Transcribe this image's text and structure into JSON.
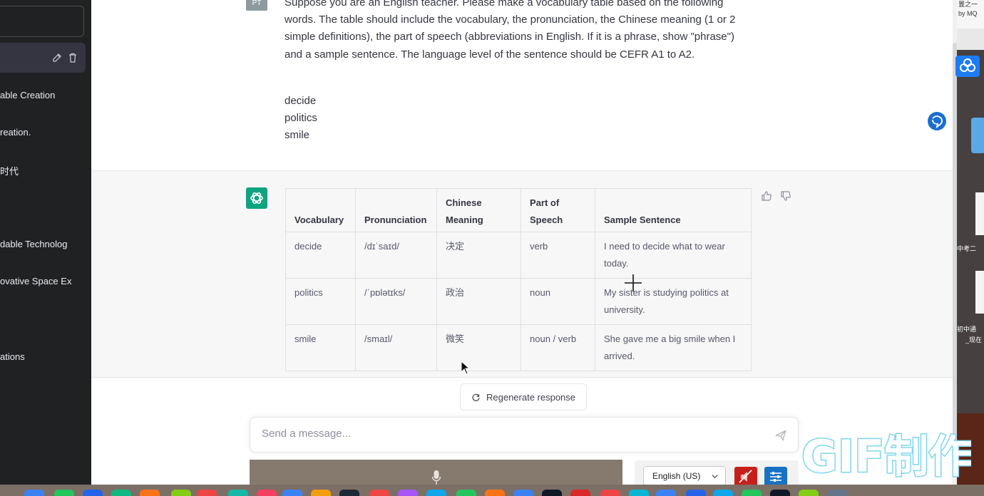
{
  "sidebar": {
    "items": [
      {
        "label": "able Creation"
      },
      {
        "label": "reation."
      },
      {
        "label": "时代"
      },
      {
        "label": "dable Technolog"
      },
      {
        "label": "ovative Space Ex"
      },
      {
        "label": "ations"
      }
    ]
  },
  "user_message": {
    "avatar_text": "PT",
    "prompt": "Suppose you are an English teacher. Please make a vocabulary table based on the following words. The table should include the vocabulary, the pronunciation, the Chinese meaning (1 or 2 simple definitions), the part of speech (abbreviations in English. If it is a phrase, show \"phrase\") and a sample sentence. The language level of the sentence should be CEFR A1 to A2.",
    "words": [
      "decide",
      "politics",
      "smile"
    ]
  },
  "assistant_message": {
    "table": {
      "headers": [
        "Vocabulary",
        "Pronunciation",
        "Chinese Meaning",
        "Part of Speech",
        "Sample Sentence"
      ],
      "rows": [
        [
          "decide",
          "/dɪˈsaɪd/",
          "决定",
          "verb",
          "I need to decide what to wear today."
        ],
        [
          "politics",
          "/ˈpɒlətɪks/",
          "政治",
          "noun",
          "My sister is studying politics at university."
        ],
        [
          "smile",
          "/smaɪl/",
          "微笑",
          "noun / verb",
          "She gave me a big smile when I arrived."
        ]
      ]
    }
  },
  "regenerate_label": "Regenerate response",
  "message_input": {
    "placeholder": "Send a message..."
  },
  "language_select": {
    "value": "English (US)"
  },
  "desktop": {
    "top_note": [
      "置之一",
      "by MQ"
    ],
    "labels": [
      "中考二",
      "初中通",
      "_现在"
    ]
  },
  "watermark_text": "GIF制作",
  "colors": {
    "sidebar_bg": "#202123",
    "assistant_bg": "#f7f7f8",
    "gpt_green": "#10a37f",
    "mute_red": "#c7201a",
    "settings_blue": "#1872c4"
  }
}
